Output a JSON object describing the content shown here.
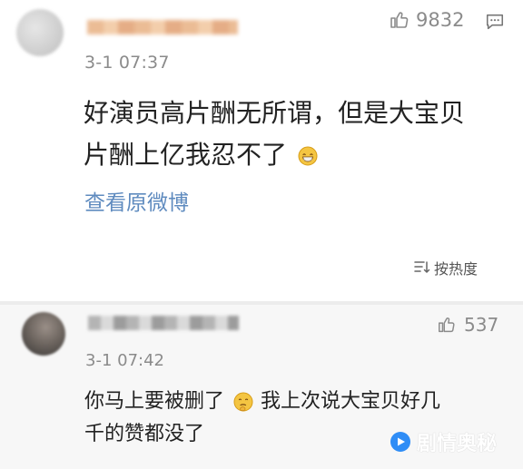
{
  "comments": [
    {
      "time": "3-1 07:37",
      "likes": "9832",
      "content_line1": "好演员高片酬无所谓，但是大宝贝",
      "content_line2": "片酬上亿我忍不了",
      "view_original": "查看原微博",
      "sort_label": "按热度"
    },
    {
      "time": "3-1 07:42",
      "likes": "537",
      "content_line1_part1": "你马上要被删了",
      "content_line1_part2": "我上次说大宝贝好几",
      "content_line2": "千的赞都没了"
    }
  ],
  "watermark": {
    "text": "剧情奥秘"
  },
  "icons": {
    "like": "thumbs-up-icon",
    "comment": "comment-icon",
    "sort": "sort-icon",
    "emoji_grin": "grin-emoji-icon",
    "emoji_think": "thinking-emoji-icon",
    "watermark_logo": "play-logo-icon"
  },
  "colors": {
    "link": "#5f8bbf",
    "text": "#222222",
    "muted": "#8b8b8b"
  }
}
